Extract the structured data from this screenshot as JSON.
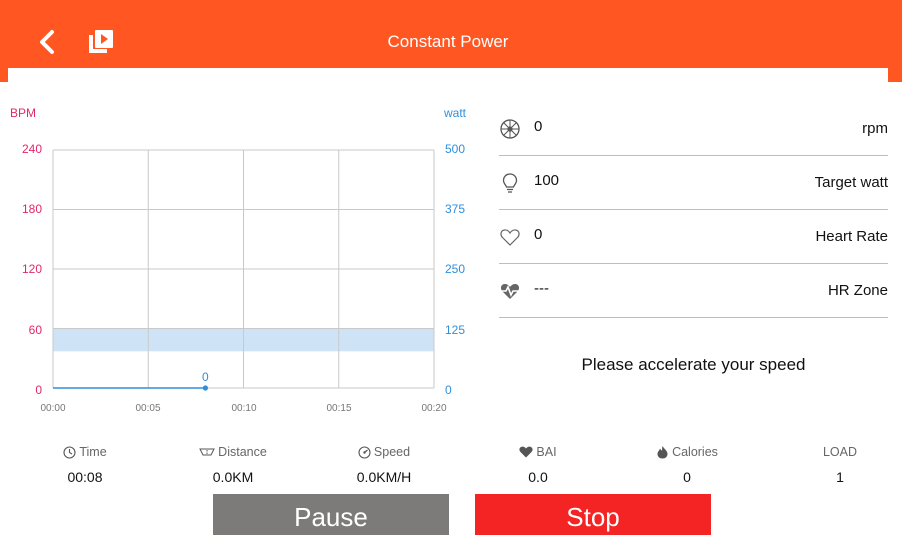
{
  "header": {
    "title": "Constant Power"
  },
  "colors": {
    "accent": "#ff5622",
    "bpm": "#e2286b",
    "watt": "#2f8fdc",
    "pause": "#7d7b7a",
    "stop": "#f52424"
  },
  "chart": {
    "left_unit": "BPM",
    "right_unit": "watt",
    "left_ticks": [
      "240",
      "180",
      "120",
      "60",
      "0"
    ],
    "right_ticks": [
      "500",
      "375",
      "250",
      "125",
      "0"
    ],
    "x_ticks": [
      "00:00",
      "00:05",
      "00:10",
      "00:15",
      "00:20"
    ]
  },
  "chart_data": {
    "type": "line",
    "x": [
      "00:00",
      "00:08"
    ],
    "series": [
      {
        "values": [
          0,
          0
        ],
        "axis": "watt"
      }
    ],
    "point_label": "0",
    "band_bpm": [
      37,
      60
    ],
    "xlim_seconds": [
      0,
      20
    ],
    "ylim_left": [
      0,
      240
    ],
    "ylim_right": [
      0,
      500
    ],
    "grid": true
  },
  "metrics": [
    {
      "icon": "wheel-icon",
      "value": "0",
      "label": "rpm"
    },
    {
      "icon": "bulb-icon",
      "value": "100",
      "label": "Target watt"
    },
    {
      "icon": "heart-outline-icon",
      "value": "0",
      "label": "Heart Rate"
    },
    {
      "icon": "heartbeat-icon",
      "value": "---",
      "label": "HR Zone"
    }
  ],
  "message": "Please accelerate your speed",
  "stats": [
    {
      "icon": "clock-icon",
      "label": "Time",
      "value": "00:08"
    },
    {
      "icon": "road-icon",
      "label": "Distance",
      "value": "0.0KM"
    },
    {
      "icon": "speedometer-icon",
      "label": "Speed",
      "value": "0.0KM/H"
    },
    {
      "icon": "bai-icon",
      "label": "BAI",
      "value": "0.0"
    },
    {
      "icon": "flame-icon",
      "label": "Calories",
      "value": "0"
    },
    {
      "icon": "",
      "label": "LOAD",
      "value": "1"
    }
  ],
  "buttons": {
    "pause": "Pause",
    "stop": "Stop"
  }
}
